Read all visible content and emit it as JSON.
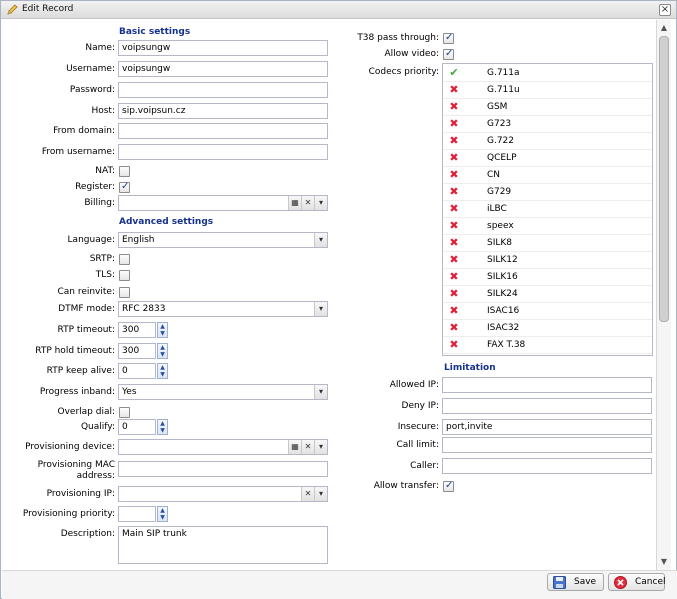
{
  "window": {
    "title": "Edit Record",
    "close_symbol": "×"
  },
  "basic": {
    "heading": "Basic settings",
    "name_label": "Name:",
    "name_value": "voipsungw",
    "username_label": "Username:",
    "username_value": "voipsungw",
    "password_label": "Password:",
    "password_value": "",
    "host_label": "Host:",
    "host_value": "sip.voipsun.cz",
    "from_domain_label": "From domain:",
    "from_domain_value": "",
    "from_username_label": "From username:",
    "from_username_value": "",
    "nat_label": "NAT:",
    "nat_checked": false,
    "register_label": "Register:",
    "register_checked": true,
    "billing_label": "Billing:",
    "billing_value": ""
  },
  "advanced": {
    "heading": "Advanced settings",
    "language_label": "Language:",
    "language_value": "English",
    "srtp_label": "SRTP:",
    "srtp_checked": false,
    "tls_label": "TLS:",
    "tls_checked": false,
    "can_reinvite_label": "Can reinvite:",
    "can_reinvite_checked": false,
    "dtmf_label": "DTMF mode:",
    "dtmf_value": "RFC 2833",
    "rtp_timeout_label": "RTP timeout:",
    "rtp_timeout_value": "300",
    "rtp_hold_timeout_label": "RTP hold timeout:",
    "rtp_hold_timeout_value": "300",
    "rtp_keep_alive_label": "RTP keep alive:",
    "rtp_keep_alive_value": "0",
    "progress_inband_label": "Progress inband:",
    "progress_inband_value": "Yes",
    "overlap_dial_label": "Overlap dial:",
    "overlap_dial_checked": false,
    "qualify_label": "Qualify:",
    "qualify_value": "0",
    "prov_device_label": "Provisioning device:",
    "prov_device_value": "",
    "prov_mac_label": "Provisioning MAC address:",
    "prov_mac_value": "",
    "prov_ip_label": "Provisioning IP:",
    "prov_ip_value": "",
    "prov_priority_label": "Provisioning priority:",
    "prov_priority_value": "",
    "description_label": "Description:",
    "description_value": "Main SIP trunk"
  },
  "right": {
    "t38_label": "T38 pass through:",
    "t38_checked": true,
    "allow_video_label": "Allow video:",
    "allow_video_checked": true,
    "codecs_label": "Codecs priority:",
    "codecs": [
      {
        "name": "G.711a",
        "enabled": true
      },
      {
        "name": "G.711u",
        "enabled": false
      },
      {
        "name": "GSM",
        "enabled": false
      },
      {
        "name": "G723",
        "enabled": false
      },
      {
        "name": "G.722",
        "enabled": false
      },
      {
        "name": "QCELP",
        "enabled": false
      },
      {
        "name": "CN",
        "enabled": false
      },
      {
        "name": "G729",
        "enabled": false
      },
      {
        "name": "iLBC",
        "enabled": false
      },
      {
        "name": "speex",
        "enabled": false
      },
      {
        "name": "SILK8",
        "enabled": false
      },
      {
        "name": "SILK12",
        "enabled": false
      },
      {
        "name": "SILK16",
        "enabled": false
      },
      {
        "name": "SILK24",
        "enabled": false
      },
      {
        "name": "ISAC16",
        "enabled": false
      },
      {
        "name": "ISAC32",
        "enabled": false
      },
      {
        "name": "FAX T.38",
        "enabled": false
      }
    ]
  },
  "limitation": {
    "heading": "Limitation",
    "allowed_ip_label": "Allowed IP:",
    "allowed_ip_value": "",
    "deny_ip_label": "Deny IP:",
    "deny_ip_value": "",
    "insecure_label": "Insecure:",
    "insecure_value": "port,invite",
    "call_limit_label": "Call limit:",
    "call_limit_value": "",
    "caller_label": "Caller:",
    "caller_value": "",
    "allow_transfer_label": "Allow transfer:",
    "allow_transfer_checked": true
  },
  "footer": {
    "save_label": "Save",
    "cancel_label": "Cancel"
  },
  "colors": {
    "section_heading": "#15318f",
    "ok_mark": "#3aa83a",
    "no_mark": "#e0223a",
    "checkbox_mark": "#1a3f9e"
  }
}
